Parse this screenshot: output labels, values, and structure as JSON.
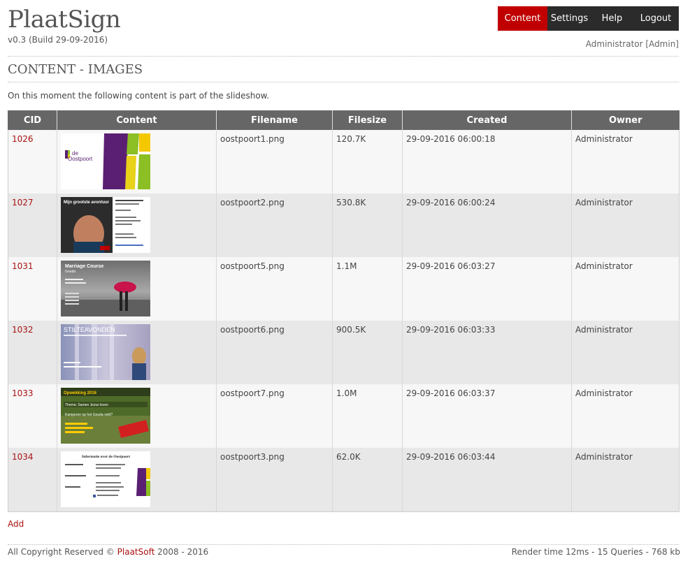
{
  "brand": {
    "title": "PlaatSign",
    "version": "v0.3 (Build 29-09-2016)"
  },
  "nav": {
    "content": "Content",
    "settings": "Settings",
    "help": "Help",
    "logout": "Logout"
  },
  "user": {
    "label": "Administrator [Admin]"
  },
  "page": {
    "title": "CONTENT - IMAGES",
    "intro": "On this moment the following content is part of the slideshow."
  },
  "table": {
    "headers": {
      "cid": "CID",
      "content": "Content",
      "filename": "Filename",
      "filesize": "Filesize",
      "created": "Created",
      "owner": "Owner"
    },
    "rows": [
      {
        "cid": "1026",
        "filename": "oostpoort1.png",
        "filesize": "120.7K",
        "created": "29-09-2016 06:00:18",
        "owner": "Administrator"
      },
      {
        "cid": "1027",
        "filename": "oostpoort2.png",
        "filesize": "530.8K",
        "created": "29-09-2016 06:00:24",
        "owner": "Administrator"
      },
      {
        "cid": "1031",
        "filename": "oostpoort5.png",
        "filesize": "1.1M",
        "created": "29-09-2016 06:03:27",
        "owner": "Administrator"
      },
      {
        "cid": "1032",
        "filename": "oostpoort6.png",
        "filesize": "900.5K",
        "created": "29-09-2016 06:03:33",
        "owner": "Administrator"
      },
      {
        "cid": "1033",
        "filename": "oostpoort7.png",
        "filesize": "1.0M",
        "created": "29-09-2016 06:03:37",
        "owner": "Administrator"
      },
      {
        "cid": "1034",
        "filename": "oostpoort3.png",
        "filesize": "62.0K",
        "created": "29-09-2016 06:03:44",
        "owner": "Administrator"
      }
    ]
  },
  "thumbs": {
    "t1": {
      "logo": "de",
      "logo2": "Oostpoort"
    },
    "t2": {
      "headline": "Mijn grootste avontuur"
    },
    "t3": {
      "headline": "Marriage Course",
      "sub": "Gouda"
    },
    "t4": {
      "headline": "STILTEAVONDEN"
    },
    "t5": {
      "headline": "Opwekking 2016",
      "sub": "Thema: Samen Jezus leven",
      "sub2": "Kamperen op het Gouda veld?"
    },
    "t6": {
      "headline": "Informatie over de Oostpoort"
    }
  },
  "actions": {
    "add": "Add"
  },
  "footer": {
    "copyright_prefix": "All Copyright Reserved ©",
    "company": "PlaatSoft",
    "copyright_suffix": "2008 - 2016",
    "stats": "Render time 12ms - 15 Queries - 768 kb"
  },
  "colors": {
    "accent": "#c00000",
    "nav_bg": "#2b2b2b",
    "header_bg": "#666666",
    "link": "#aa1111"
  }
}
